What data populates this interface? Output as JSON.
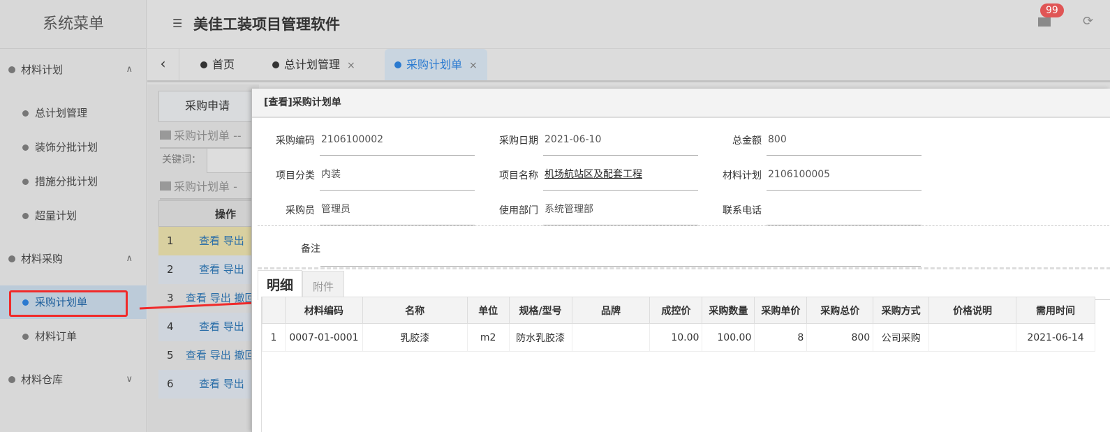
{
  "sidebar": {
    "title": "系统菜单",
    "groups": [
      {
        "label": "材料计划",
        "chev": "∧",
        "items": [
          "总计划管理",
          "装饰分批计划",
          "措施分批计划",
          "超量计划"
        ]
      },
      {
        "label": "材料采购",
        "chev": "∧",
        "items": [
          "采购计划单",
          "材料订单"
        ]
      },
      {
        "label": "材料仓库",
        "chev": "∨"
      }
    ],
    "active_item": "采购计划单"
  },
  "header": {
    "menu_icon": "list-icon",
    "title": "美佳工装项目管理软件",
    "mail_badge": "99",
    "badge_color": "#e05555"
  },
  "tabs": [
    {
      "label": "首页"
    },
    {
      "label": "总计划管理",
      "close": "×"
    },
    {
      "label": "采购计划单",
      "close": "×",
      "active": true
    }
  ],
  "background": {
    "button": "采购申请",
    "section1": "采购计划单 --",
    "keyword_label": "关键词：",
    "section2": "采购计划单 - ",
    "col_action": "操作",
    "rows": [
      {
        "n": "1",
        "actions": "查看 导出"
      },
      {
        "n": "2",
        "actions": "查看 导出"
      },
      {
        "n": "3",
        "actions": "查看 导出 撤回"
      },
      {
        "n": "4",
        "actions": "查看 导出"
      },
      {
        "n": "5",
        "actions": "查看 导出 撤回"
      },
      {
        "n": "6",
        "actions": "查看 导出"
      }
    ]
  },
  "modal": {
    "title": "[查看]采购计划单",
    "fields": [
      {
        "label": "采购编码",
        "value": "2106100002"
      },
      {
        "label": "采购日期",
        "value": "2021-06-10"
      },
      {
        "label": "总金额",
        "value": "800"
      },
      {
        "label": "项目分类",
        "value": "内装"
      },
      {
        "label": "项目名称",
        "value": "机场航站区及配套工程"
      },
      {
        "label": "材料计划",
        "value": "2106100005"
      },
      {
        "label": "采购员",
        "value": "管理员"
      },
      {
        "label": "使用部门",
        "value": "系统管理部"
      },
      {
        "label": "联系电话",
        "value": ""
      }
    ],
    "remark_label": "备注",
    "subtabs": [
      "明细",
      "附件"
    ],
    "table": {
      "headers": [
        "",
        "材料编码",
        "名称",
        "单位",
        "规格/型号",
        "品牌",
        "成控价",
        "采购数量",
        "采购单价",
        "采购总价",
        "采购方式",
        "价格说明",
        "需用时间"
      ],
      "rows": [
        [
          "1",
          "0007-01-0001",
          "乳胶漆",
          "m2",
          "防水乳胶漆",
          "",
          "10.00",
          "100.00",
          "8",
          "800",
          "公司采购",
          "",
          "2021-06-14"
        ]
      ]
    }
  },
  "annotation_color": "#f02a2a"
}
